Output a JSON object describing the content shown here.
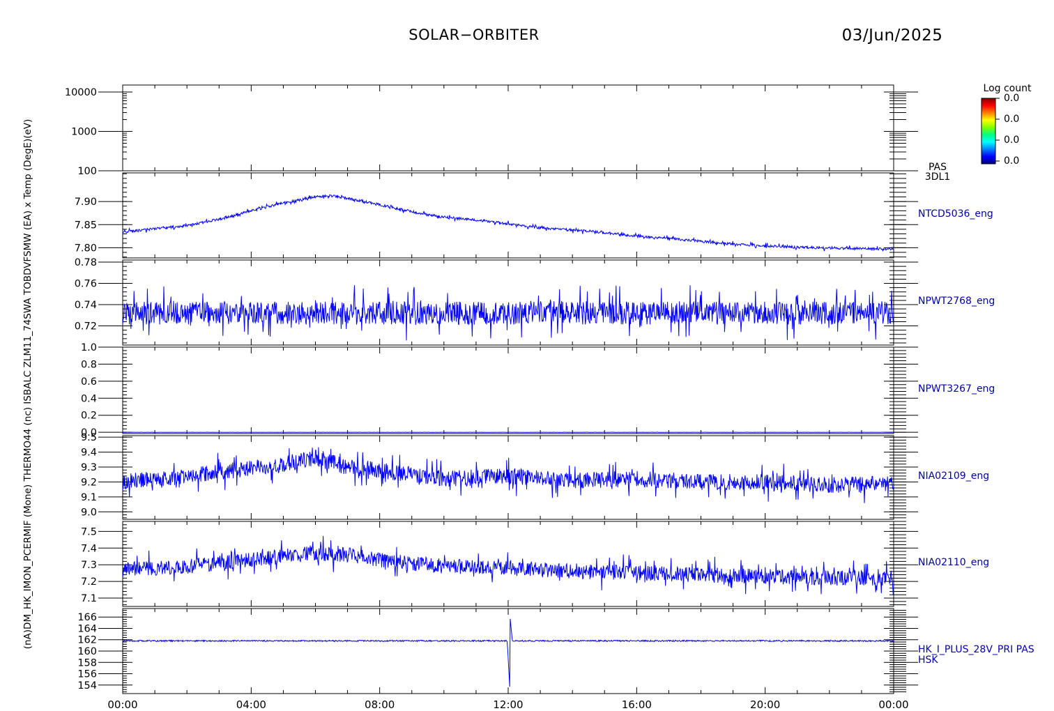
{
  "header": {
    "title": "SOLAR−ORBITER",
    "date": "03/Jun/2025"
  },
  "time_axis": {
    "ticks": [
      "00:00",
      "04:00",
      "08:00",
      "12:00",
      "16:00",
      "20:00",
      "00:00"
    ],
    "range_hours": [
      0,
      24
    ]
  },
  "colorbar": {
    "title": "Log count",
    "labels": [
      "0.0",
      "0.0",
      "0.0",
      "0.0"
    ],
    "colors": [
      "#000080",
      "#0000ff",
      "#0080ff",
      "#00ffff",
      "#00ff80",
      "#80ff00",
      "#ffff00",
      "#ff8000",
      "#ff0000",
      "#800000"
    ]
  },
  "colors": {
    "data": "#0000ff",
    "text": "#000000",
    "right_label": "#0000aa"
  },
  "y_title_overlap": "(nA)DM_HK_IMON_PCERMIF (Mone) THERMO44 (nc) ISBALC ZLM11_74SWA TOBDVFSMW (EA) x Temp (DegE)(eV)",
  "chart_data": [
    {
      "type": "heatmap",
      "panel": "PAS 3DL1",
      "right_label": [
        "PAS",
        "3DL1"
      ],
      "yscale": "log",
      "ylim": [
        100,
        15000
      ],
      "yticks": [
        100,
        1000,
        10000
      ],
      "ytick_labels": [
        "100",
        "1000",
        "10000"
      ],
      "values": []
    },
    {
      "type": "line",
      "panel": "NTCD5036_eng",
      "right_label": [
        "NTCD5036_eng"
      ],
      "ylim": [
        7.778,
        7.962
      ],
      "yticks": [
        7.8,
        7.85,
        7.9
      ],
      "ytick_labels": [
        "7.80",
        "7.85",
        "7.90"
      ],
      "x": [
        0,
        1,
        2,
        3,
        4,
        5,
        6,
        6.5,
        7,
        8,
        9,
        10,
        11,
        12,
        13,
        14,
        15,
        16,
        17,
        18,
        19,
        20,
        21,
        22,
        23,
        24
      ],
      "y": [
        7.834,
        7.841,
        7.848,
        7.862,
        7.88,
        7.897,
        7.91,
        7.912,
        7.907,
        7.893,
        7.878,
        7.866,
        7.86,
        7.852,
        7.843,
        7.838,
        7.833,
        7.825,
        7.82,
        7.814,
        7.808,
        7.804,
        7.801,
        7.799,
        7.798,
        7.797
      ],
      "noise": 0.003
    },
    {
      "type": "line",
      "panel": "NPWT2768_eng",
      "right_label": [
        "NPWT2768_eng"
      ],
      "ylim": [
        0.702,
        0.782
      ],
      "yticks": [
        0.72,
        0.74,
        0.76,
        0.78
      ],
      "ytick_labels": [
        "0.72",
        "0.74",
        "0.76",
        "0.78"
      ],
      "baseline": 0.732,
      "noise": 0.012
    },
    {
      "type": "line",
      "panel": "NPWT3267_eng",
      "right_label": [
        "NPWT3267_eng"
      ],
      "ylim": [
        -0.015,
        1.0
      ],
      "yticks": [
        0.0,
        0.2,
        0.4,
        0.6,
        0.8,
        1.0
      ],
      "ytick_labels": [
        "0.0",
        "0.2",
        "0.4",
        "0.6",
        "0.8",
        "1.0"
      ],
      "baseline": 0.0
    },
    {
      "type": "line",
      "panel": "NIA02109_eng",
      "right_label": [
        "NIA02109_eng"
      ],
      "ylim": [
        8.95,
        9.51
      ],
      "yticks": [
        9.0,
        9.1,
        9.2,
        9.3,
        9.4,
        9.5
      ],
      "ytick_labels": [
        "9.0",
        "9.1",
        "9.2",
        "9.3",
        "9.4",
        "9.5"
      ],
      "x": [
        0,
        2,
        3.5,
        5,
        6,
        7,
        8,
        9,
        10,
        12,
        14,
        16,
        18,
        20,
        22,
        24
      ],
      "y": [
        9.2,
        9.24,
        9.28,
        9.32,
        9.36,
        9.3,
        9.28,
        9.25,
        9.22,
        9.24,
        9.21,
        9.22,
        9.2,
        9.2,
        9.18,
        9.19
      ],
      "noise": 0.06
    },
    {
      "type": "line",
      "panel": "NIA02110_eng",
      "right_label": [
        "NIA02110_eng"
      ],
      "ylim": [
        7.05,
        7.56
      ],
      "yticks": [
        7.1,
        7.2,
        7.3,
        7.4,
        7.5
      ],
      "ytick_labels": [
        "7.1",
        "7.2",
        "7.3",
        "7.4",
        "7.5"
      ],
      "x": [
        0,
        2,
        4,
        5,
        6,
        7,
        8,
        10,
        12,
        14,
        16,
        18,
        20,
        22,
        24
      ],
      "y": [
        7.27,
        7.29,
        7.33,
        7.35,
        7.37,
        7.36,
        7.33,
        7.29,
        7.28,
        7.26,
        7.25,
        7.24,
        7.23,
        7.22,
        7.22
      ],
      "noise": 0.05
    },
    {
      "type": "line",
      "panel": "HK_I_PLUS_28V_PRI PAS HSK",
      "right_label": [
        "HK_I_PLUS_28V_PRI PAS",
        "HSK"
      ],
      "ylim": [
        152.5,
        167.5
      ],
      "yticks": [
        154,
        156,
        158,
        160,
        162,
        164,
        166
      ],
      "ytick_labels": [
        "154",
        "156",
        "158",
        "160",
        "162",
        "164",
        "166"
      ],
      "baseline": 161.8,
      "spike": {
        "x": 12.05,
        "min": 153.5,
        "max": 166.5
      }
    }
  ]
}
